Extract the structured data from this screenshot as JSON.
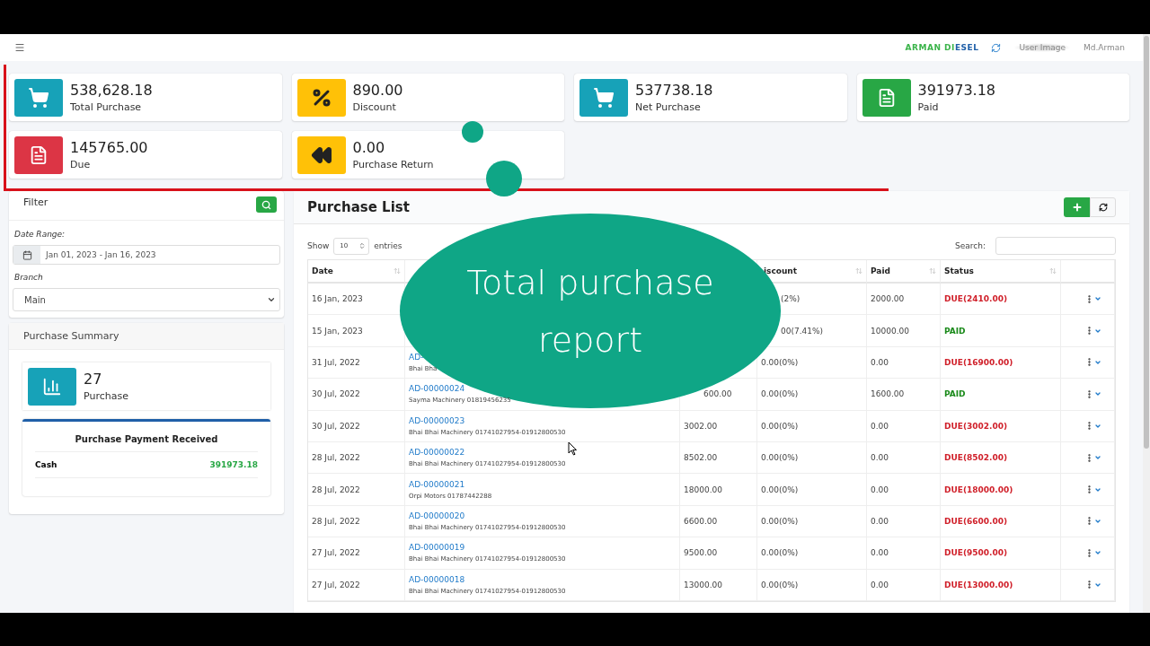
{
  "header": {
    "brand": [
      {
        "text": "ARMAN DI",
        "color": "#3cb44b"
      },
      {
        "text": "ESEL",
        "color": "#1f5fa8"
      }
    ],
    "avatar_alt": "User Image",
    "user": "Md.Arman"
  },
  "stats": [
    {
      "value": "538,628.18",
      "label": "Total Purchase",
      "kind": "cart",
      "color": "#17a2b8"
    },
    {
      "value": "890.00",
      "label": "Discount",
      "kind": "percent",
      "color": "#ffc107"
    },
    {
      "value": "537738.18",
      "label": "Net Purchase",
      "kind": "cart",
      "color": "#17a2b8"
    },
    {
      "value": "391973.18",
      "label": "Paid",
      "kind": "file",
      "color": "#28a745"
    },
    {
      "value": "145765.00",
      "label": "Due",
      "kind": "file",
      "color": "#dc3545"
    },
    {
      "value": "0.00",
      "label": "Purchase Return",
      "kind": "rewind",
      "color": "#ffc107"
    }
  ],
  "filter": {
    "title": "Filter",
    "date_label": "Date Range:",
    "date_value": "Jan 01, 2023 - Jan 16, 2023",
    "branch_label": "Branch",
    "branch_value": "Main"
  },
  "summary": {
    "title": "Purchase Summary",
    "count": "27",
    "count_label": "Purchase",
    "payment_title": "Purchase Payment Received",
    "payments": [
      {
        "method": "Cash",
        "amount": "391973.18"
      }
    ]
  },
  "purchase_list": {
    "title": "Purchase List",
    "show_label": "Show",
    "page_size": "10",
    "entries_label": "entries",
    "search_label": "Search:",
    "columns": [
      {
        "label": "Date",
        "sortable": true
      },
      {},
      {},
      {
        "label": "iscount",
        "sortable": true,
        "clipped": true
      },
      {
        "label": "Paid",
        "sortable": true
      },
      {
        "label": "Status",
        "sortable": true
      },
      {}
    ],
    "rows": [
      {
        "date": "16 Jan, 2023",
        "discount": "(2%)",
        "discount_clipped": true,
        "paid": "2000.00",
        "status": "DUE(2410.00)",
        "kind": "due"
      },
      {
        "date": "15 Jan, 2023",
        "discount": "00(7.41%)",
        "discount_clipped": true,
        "paid": "10000.00",
        "status": "PAID",
        "kind": "paid"
      },
      {
        "date": "31 Jul, 2022",
        "invoice": "AD-",
        "supplier": "Bhai Bha",
        "discount": "0.00(0%)",
        "paid": "0.00",
        "status": "DUE(16900.00)",
        "kind": "due"
      },
      {
        "date": "30 Jul, 2022",
        "invoice": "AD-00000024",
        "supplier": "Sayma Machinery 01819456235",
        "total": "600.00",
        "total_clipped": true,
        "discount": "0.00(0%)",
        "paid": "1600.00",
        "status": "PAID",
        "kind": "paid"
      },
      {
        "date": "30 Jul, 2022",
        "invoice": "AD-00000023",
        "supplier": "Bhai Bhai Machinery 01741027954-01912800530",
        "total": "3002.00",
        "discount": "0.00(0%)",
        "paid": "0.00",
        "status": "DUE(3002.00)",
        "kind": "due"
      },
      {
        "date": "28 Jul, 2022",
        "invoice": "AD-00000022",
        "supplier": "Bhai Bhai Machinery 01741027954-01912800530",
        "total": "8502.00",
        "discount": "0.00(0%)",
        "paid": "0.00",
        "status": "DUE(8502.00)",
        "kind": "due"
      },
      {
        "date": "28 Jul, 2022",
        "invoice": "AD-00000021",
        "supplier": "Orpi Motors 01787442288",
        "total": "18000.00",
        "discount": "0.00(0%)",
        "paid": "0.00",
        "status": "DUE(18000.00)",
        "kind": "due"
      },
      {
        "date": "28 Jul, 2022",
        "invoice": "AD-00000020",
        "supplier": "Bhai Bhai Machinery 01741027954-01912800530",
        "total": "6600.00",
        "discount": "0.00(0%)",
        "paid": "0.00",
        "status": "DUE(6600.00)",
        "kind": "due"
      },
      {
        "date": "27 Jul, 2022",
        "invoice": "AD-00000019",
        "supplier": "Bhai Bhai Machinery 01741027954-01912800530",
        "total": "9500.00",
        "discount": "0.00(0%)",
        "paid": "0.00",
        "status": "DUE(9500.00)",
        "kind": "due"
      },
      {
        "date": "27 Jul, 2022",
        "invoice": "AD-00000018",
        "supplier": "Bhai Bhai Machinery 01741027954-01912800530",
        "total": "13000.00",
        "discount": "0.00(0%)",
        "paid": "0.00",
        "status": "DUE(13000.00)",
        "kind": "due"
      }
    ]
  },
  "overlay": {
    "caption": "Total purchase report"
  }
}
